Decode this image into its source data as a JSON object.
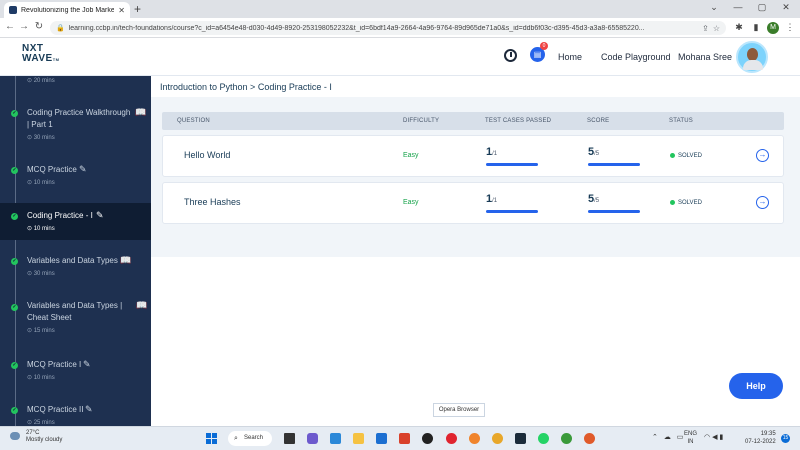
{
  "browser": {
    "tab_title": "Revolutionizing the Job Market | ",
    "url": "learning.ccbp.in/tech-foundations/course?c_id=a6454e48-d030-4d49-8920-253198052232&t_id=6bdf14a9-2664-4a96-9764-89d965de71a0&s_id=ddb6f03c-d395-45d3-a3a8-65585220...",
    "profile_initial": "M"
  },
  "header": {
    "logo_line1": "NXT",
    "logo_line2": "WAVE",
    "logo_tm": "TM",
    "chat_badge": "0",
    "nav": [
      "Home",
      "Code Playground"
    ],
    "user_name": "Mohana Sree"
  },
  "sidebar": {
    "top_duration": "20 mins",
    "items": [
      {
        "label": "Coding Practice Walkthrough | Part 1",
        "duration": "30 mins",
        "icon": "book-icon"
      },
      {
        "label": "MCQ Practice",
        "duration": "10 mins",
        "icon": "pencil-icon"
      },
      {
        "label": "Coding Practice - I",
        "duration": "10 mins",
        "icon": "pencil-icon",
        "active": true
      },
      {
        "label": "Variables and Data Types",
        "duration": "30 mins",
        "icon": "book-icon"
      },
      {
        "label": "Variables and Data Types | Cheat Sheet",
        "duration": "15 mins",
        "icon": "book-icon"
      },
      {
        "label": "MCQ Practice I",
        "duration": "10 mins",
        "icon": "pencil-icon"
      },
      {
        "label": "MCQ Practice II",
        "duration": "25 mins",
        "icon": "pencil-icon"
      }
    ]
  },
  "breadcrumb": "Introduction to Python > Coding Practice - I",
  "table": {
    "headers": [
      "QUESTION",
      "DIFFICULTY",
      "TEST CASES PASSED",
      "SCORE",
      "STATUS"
    ],
    "rows": [
      {
        "question": "Hello World",
        "difficulty": "Easy",
        "tc_num": "1",
        "tc_den": "/1",
        "score_num": "5",
        "score_den": "/5",
        "status": "SOLVED"
      },
      {
        "question": "Three Hashes",
        "difficulty": "Easy",
        "tc_num": "1",
        "tc_den": "/1",
        "score_num": "5",
        "score_den": "/5",
        "status": "SOLVED"
      }
    ]
  },
  "help_label": "Help",
  "tooltip": "Opera Browser",
  "taskbar": {
    "temp": "27°C",
    "weather": "Mostly cloudy",
    "search": "Search",
    "lang1": "ENG",
    "lang2": "IN",
    "time": "19:35",
    "date": "07-12-2022",
    "notif_count": "15"
  },
  "colors": {
    "sidebar": "#1e3050",
    "accent": "#2563eb",
    "success": "#22c55e"
  }
}
